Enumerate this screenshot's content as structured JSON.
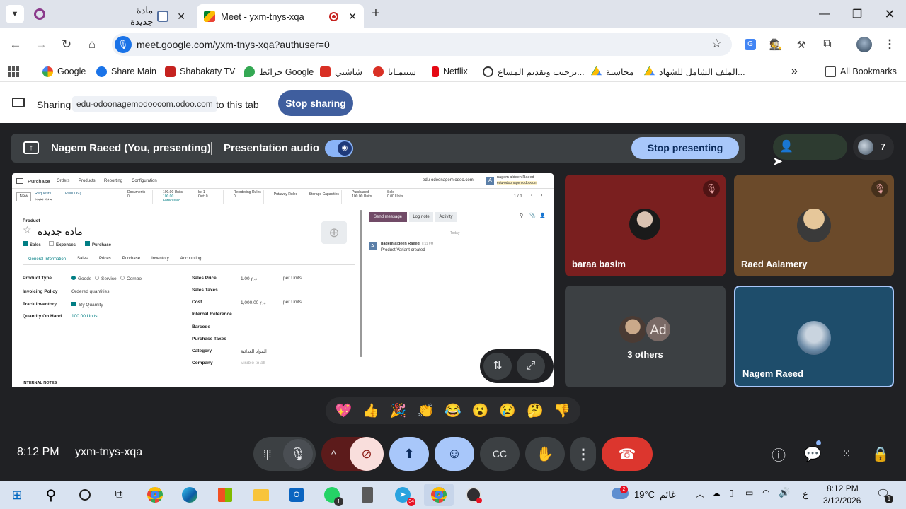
{
  "browser": {
    "tabs": [
      {
        "title": "مادة جديدة",
        "active": false
      },
      {
        "title": "Meet - yxm-tnys-xqa",
        "active": true
      }
    ],
    "new_tab_symbol": "+",
    "url": "meet.google.com/yxm-tnys-xqa?authuser=0",
    "bookmarks": [
      {
        "label": "Google",
        "color": "#4285f4"
      },
      {
        "label": "Share Main",
        "color": "#1a73e8"
      },
      {
        "label": "Shabakaty TV",
        "color": "#c5221f"
      },
      {
        "label": "خرائط Google",
        "color": "#34a853"
      },
      {
        "label": "شاشتي",
        "color": "#d93025"
      },
      {
        "label": "سينمـانا",
        "color": "#d93025"
      },
      {
        "label": "Netflix",
        "color": "#e50914"
      },
      {
        "label": "ترحيب وتقديم المساع...",
        "color": "#5f6368"
      },
      {
        "label": "محاسبة",
        "color": "#0f9d58"
      },
      {
        "label": "الملف الشامل للشهاد...",
        "color": "#0f9d58"
      }
    ],
    "more_bookmarks": "»",
    "all_bookmarks": "All Bookmarks"
  },
  "sharing_bar": {
    "sharing_label": "Sharing",
    "shared_domain": "edu-odoonagemodoocom.odoo.com",
    "to_this_tab": "to this tab",
    "stop_sharing": "Stop sharing"
  },
  "meet": {
    "presenter_text": "Nagem Raeed (You, presenting)",
    "presentation_audio": "Presentation audio",
    "stop_presenting": "Stop presenting",
    "participant_count": "7",
    "tiles": [
      {
        "name": "baraa basim",
        "muted": true,
        "bg": "#7a1f1f"
      },
      {
        "name": "Raed Aalamery",
        "muted": true,
        "bg": "#6b4a2a"
      },
      {
        "name": "3 others",
        "avatar_initials": "Ad"
      },
      {
        "name": "Nagem Raeed",
        "muted": false,
        "bg": "#1e4d6b"
      }
    ],
    "reactions": [
      "💖",
      "👍",
      "🎉",
      "👏",
      "😂",
      "😮",
      "😢",
      "🤔",
      "👎"
    ],
    "time": "8:12 PM",
    "meeting_code": "yxm-tnys-xqa"
  },
  "odoo": {
    "app": "Purchase",
    "menu": [
      "Orders",
      "Products",
      "Reporting",
      "Configuration"
    ],
    "domain": "edu-odoonagem.odoo.com",
    "user": "nagem aldeen Raeed",
    "user_db": "edu-odoonagemodoocom",
    "new_btn": "New",
    "breadcrumb_parent": "Requests ...",
    "breadcrumb_code": "P00006 (...",
    "breadcrumb_current": "مادة جديدة",
    "stats": [
      {
        "label": "Documents",
        "value": "0"
      },
      {
        "label": "100.00 Units",
        "value": "100.00 Forecasted"
      },
      {
        "label": "In: 1",
        "value": "Out: 0"
      },
      {
        "label": "Reordering Rules",
        "value": "0"
      },
      {
        "label": "Putaway Rules",
        "value": ""
      },
      {
        "label": "Storage Capacities",
        "value": ""
      },
      {
        "label": "Purchased",
        "value": "100.00 Units"
      },
      {
        "label": "Sold",
        "value": "0.00 Units"
      }
    ],
    "pager": "1 / 1",
    "product_label": "Product",
    "product_name": "مادة جديدة",
    "checks": [
      "Sales",
      "Expenses",
      "Purchase"
    ],
    "form_tabs": [
      "General Information",
      "Sales",
      "Prices",
      "Purchase",
      "Inventory",
      "Accounting"
    ],
    "left_fields": [
      {
        "label": "Product Type",
        "value": "Goods"
      },
      {
        "label": "Invoicing Policy",
        "value": "Ordered quantities"
      },
      {
        "label": "Track Inventory",
        "value": "By Quantity"
      },
      {
        "label": "Quantity On Hand",
        "value": "100.00 Units"
      }
    ],
    "product_type_options": [
      "Goods",
      "Service",
      "Combo"
    ],
    "right_fields": [
      {
        "label": "Sales Price",
        "value": "1.00 د.ع",
        "unit": "per Units"
      },
      {
        "label": "Sales Taxes",
        "value": "",
        "unit": ""
      },
      {
        "label": "Cost",
        "value": "1,000.00 د.ع",
        "unit": "per Units"
      },
      {
        "label": "Internal Reference",
        "value": "",
        "unit": ""
      },
      {
        "label": "Barcode",
        "value": "",
        "unit": ""
      },
      {
        "label": "Purchase Taxes",
        "value": "",
        "unit": ""
      },
      {
        "label": "Category",
        "value": "المواد الغذائية",
        "unit": ""
      },
      {
        "label": "Company",
        "value": "Visible to all",
        "unit": ""
      }
    ],
    "internal_notes": "INTERNAL NOTES",
    "chatter_buttons": [
      "Send message",
      "Log note",
      "Activity"
    ],
    "today": "Today",
    "message_author": "nagem aldeen Raeed",
    "message_time": "8:11 PM",
    "message_text": "Product Variant created"
  },
  "taskbar": {
    "weather_temp": "19°C",
    "weather_text": "غائم",
    "weather_badge": "2",
    "lang": "ع",
    "clock_time": "8:12 PM",
    "clock_date": "3/12/2026",
    "whatsapp_badge": "1",
    "telegram_badge": "34",
    "notif_badge": "1"
  }
}
